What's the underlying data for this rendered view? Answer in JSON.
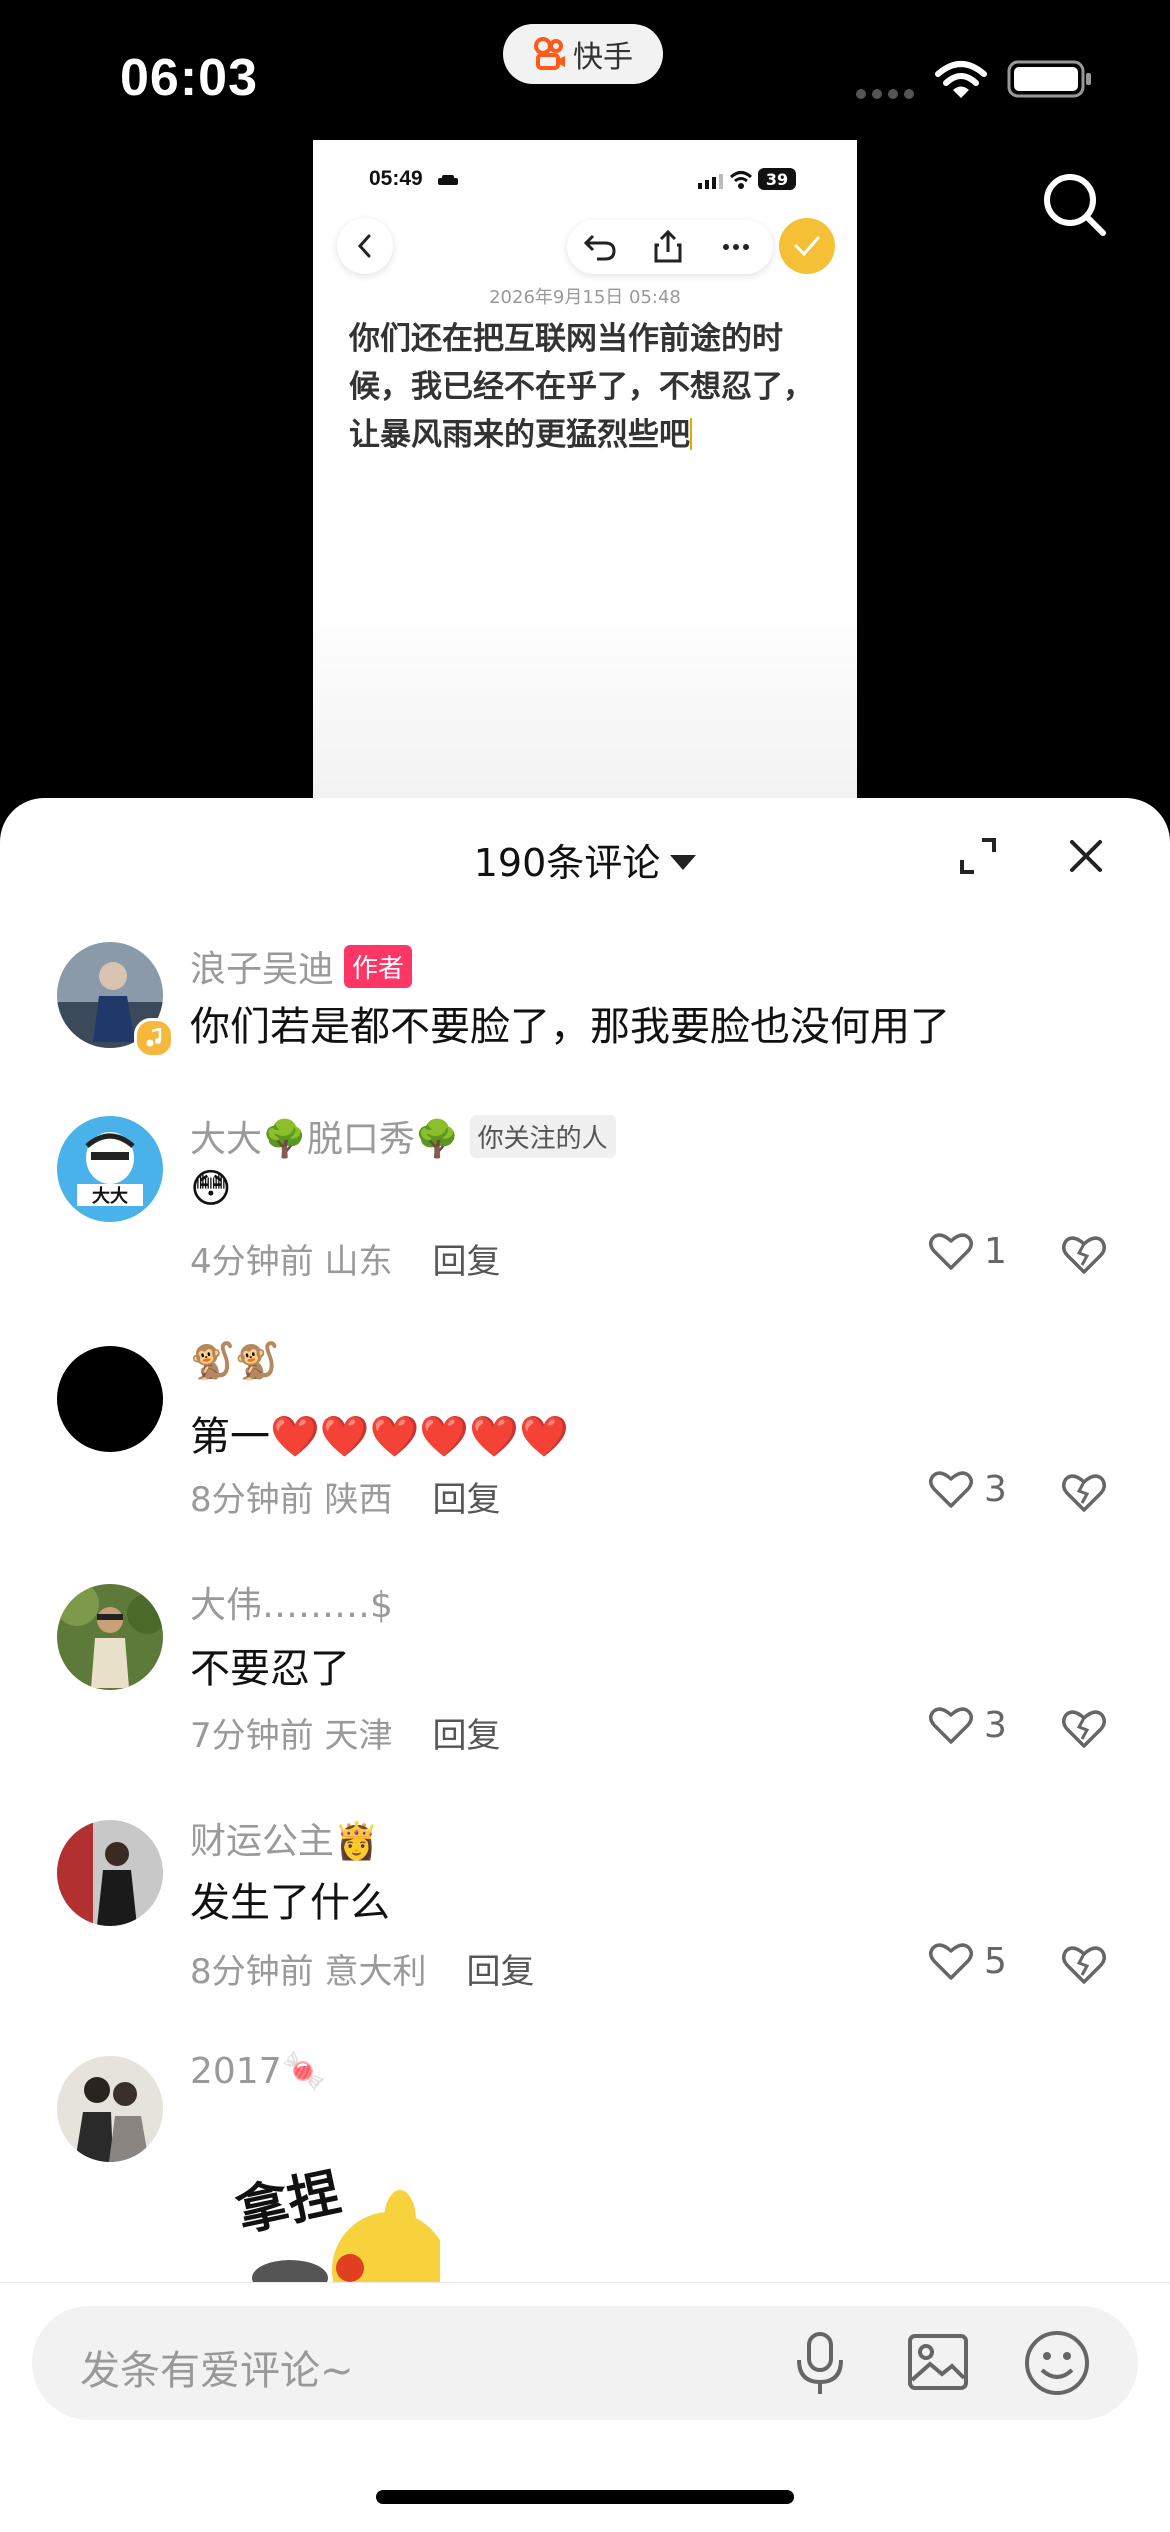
{
  "status_bar": {
    "time": "06:03",
    "app_name": "快手"
  },
  "inner_screen": {
    "time": "05:49",
    "battery": "39",
    "date": "2026年9月15日 05:48",
    "note_text": "你们还在把互联网当作前途的时候，我已经不在乎了，不想忍了，让暴风雨来的更猛烈些吧"
  },
  "comments_header": {
    "title": "190条评论"
  },
  "comments": [
    {
      "user": "浪子吴迪",
      "tag": "作者",
      "text": "你们若是都不要脸了，那我要脸也没何用了"
    },
    {
      "user": "大大🌳脱口秀🌳",
      "tag": "你关注的人",
      "text": "😳",
      "time": "4分钟前",
      "location": "山东",
      "reply": "回复",
      "likes": "1"
    },
    {
      "user": "🐒🐒",
      "text": "第一❤️❤️❤️❤️❤️❤️",
      "time": "8分钟前",
      "location": "陕西",
      "reply": "回复",
      "likes": "3"
    },
    {
      "user": "大伟………$",
      "text": "不要忍了",
      "time": "7分钟前",
      "location": "天津",
      "reply": "回复",
      "likes": "3"
    },
    {
      "user": "财运公主👸",
      "text": "发生了什么",
      "time": "8分钟前",
      "location": "意大利",
      "reply": "回复",
      "likes": "5"
    },
    {
      "user": "2017🍬",
      "sticker_text": "拿捏"
    }
  ],
  "input_bar": {
    "placeholder": "发条有爱评论~"
  },
  "colors": {
    "accent": "#fe3666",
    "brand": "#ff6b1a",
    "check": "#f5c036"
  }
}
